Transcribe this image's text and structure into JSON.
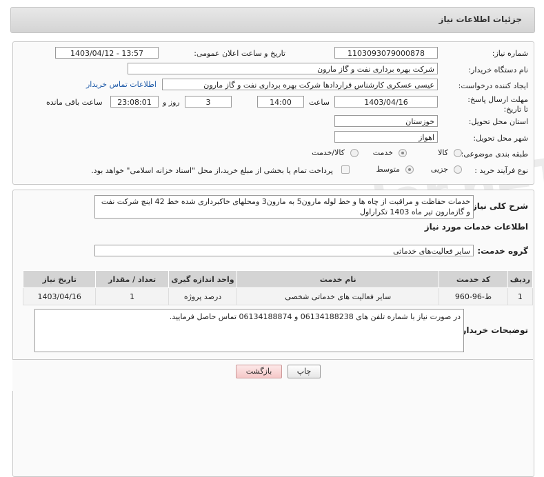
{
  "header": {
    "title": "جزئیات اطلاعات نیاز"
  },
  "info": {
    "need_number_label": "شماره نیاز:",
    "need_number": "1103093079000878",
    "announce_label": "تاریخ و ساعت اعلان عمومی:",
    "announce_value": "1403/04/12 - 13:57",
    "buyer_label": "نام دستگاه خریدار:",
    "buyer_value": "شرکت بهره برداری نفت و گاز مارون",
    "creator_label": "ایجاد کننده درخواست:",
    "creator_value": "عیسی عسکری کارشناس قراردادها شرکت بهره برداری نفت و گاز مارون",
    "contact_link": "اطلاعات تماس خریدار",
    "deadline_label": "مهلت ارسال پاسخ: تا تاریخ:",
    "deadline_date": "1403/04/16",
    "time_label": "ساعت",
    "deadline_time": "14:00",
    "days_value": "3",
    "days_label": "روز و",
    "remaining_time": "23:08:01",
    "remaining_label": "ساعت باقی مانده",
    "province_label": "استان محل تحویل:",
    "province_value": "خوزستان",
    "city_label": "شهر محل تحویل:",
    "city_value": "اهواز",
    "category_label": "طبقه بندی موضوعی:",
    "category_options": [
      "کالا",
      "خدمت",
      "کالا/خدمت"
    ],
    "process_label": "نوع فرآیند خرید :",
    "process_options": [
      "جزیی",
      "متوسط"
    ],
    "payment_note": "پرداخت تمام یا بخشی از مبلغ خرید،از محل \"اسناد خزانه اسلامی\" خواهد بود."
  },
  "description": {
    "label": "شرح کلی نیاز:",
    "text": "خدمات حفاظت و مراقبت از چاه ها و خط لوله مارون5 به مارون3 ومحلهای خاکبرداری شده خط 42 اینچ شرکت نفت و گازمارون تیر ماه 1403 تکراراول"
  },
  "services": {
    "section_title": "اطلاعات خدمات مورد نیاز",
    "group_label": "گروه خدمت:",
    "group_value": "سایر فعالیت‌های خدماتی",
    "columns": [
      "ردیف",
      "کد خدمت",
      "نام خدمت",
      "واحد اندازه گیری",
      "تعداد / مقدار",
      "تاریخ نیاز"
    ],
    "rows": [
      [
        "1",
        "ط-96-960",
        "سایر فعالیت های خدماتی شخصی",
        "درصد پروژه",
        "1",
        "1403/04/16"
      ]
    ]
  },
  "buyer_notes": {
    "label": "توضیحات خریدار:",
    "text": "در صورت نیاز با شماره تلفن های 06134188238 و 06134188874 تماس حاصل فرمایید."
  },
  "buttons": {
    "print": "چاپ",
    "back": "بازگشت"
  },
  "watermark": "AriaTender.neT"
}
